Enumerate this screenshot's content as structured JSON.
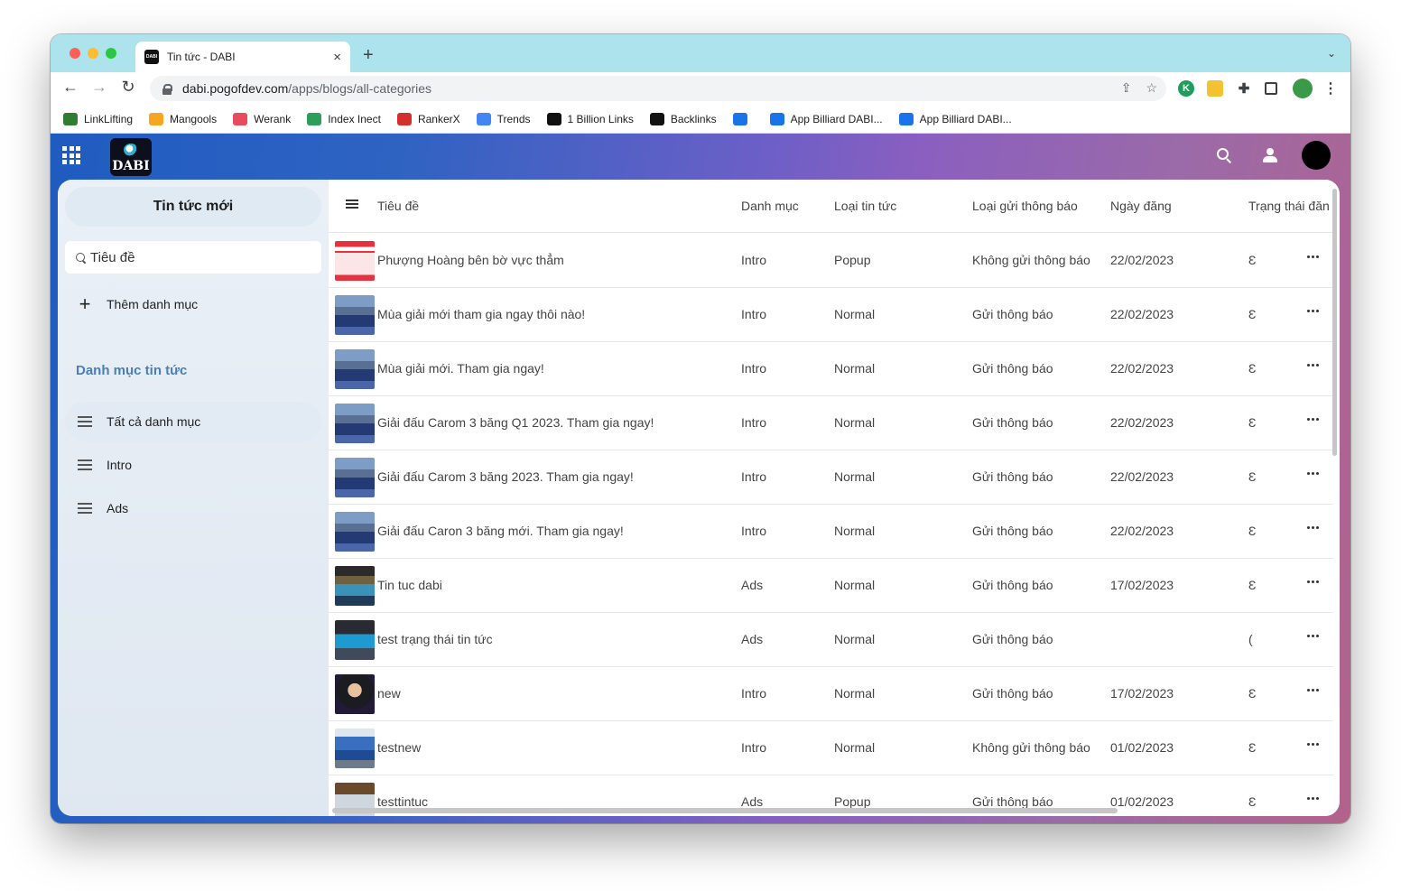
{
  "browser": {
    "tab_title": "Tin tức - DABI",
    "new_tab": "+",
    "url_domain": "dabi.pogofdev.com",
    "url_path": "/apps/blogs/all-categories",
    "tab_close": "×",
    "tab_dropdown": "⌄",
    "favicon_text": "DABI"
  },
  "bookmarks": [
    {
      "label": "LinkLifting",
      "icon_color": "#2e7d32"
    },
    {
      "label": "Mangools",
      "icon_color": "#f5a623"
    },
    {
      "label": "Werank",
      "icon_color": "#e84b5c"
    },
    {
      "label": "Index Inect",
      "icon_color": "#2e9c5a"
    },
    {
      "label": "RankerX",
      "icon_color": "#d32f2f"
    },
    {
      "label": "Trends",
      "icon_color": "#4285f4"
    },
    {
      "label": "1 Billion Links",
      "icon_color": "#111111"
    },
    {
      "label": "Backlinks",
      "icon_color": "#111111"
    },
    {
      "label": "",
      "icon_color": "#1a73e8"
    },
    {
      "label": "App Billiard DABI...",
      "icon_color": "#1a73e8"
    },
    {
      "label": "App Billiard DABI...",
      "icon_color": "#1a73e8"
    }
  ],
  "app": {
    "logo": "DABI"
  },
  "sidebar": {
    "new_button": "Tin tức mới",
    "search_placeholder": "Tiêu đề",
    "add_category": "Thêm danh mục",
    "section_title": "Danh mục tin tức",
    "categories": [
      {
        "label": "Tất cả danh mục",
        "active": true
      },
      {
        "label": "Intro",
        "active": false
      },
      {
        "label": "Ads",
        "active": false
      }
    ]
  },
  "table": {
    "columns": [
      "Tiêu đề",
      "Danh mục",
      "Loại tin tức",
      "Loại gửi thông báo",
      "Ngày đăng",
      "Trạng thái đăn"
    ],
    "rows": [
      {
        "title": "Phượng Hoàng bên bờ vực thẳm",
        "category": "Intro",
        "type": "Popup",
        "notify": "Không gửi thông báo",
        "date": "22/02/2023",
        "status": "Ɛ",
        "thumb": "a"
      },
      {
        "title": "Mùa giải mới tham gia ngay thôi nào!",
        "category": "Intro",
        "type": "Normal",
        "notify": "Gửi thông báo",
        "date": "22/02/2023",
        "status": "Ɛ",
        "thumb": "b"
      },
      {
        "title": "Mùa giải mới. Tham gia ngay!",
        "category": "Intro",
        "type": "Normal",
        "notify": "Gửi thông báo",
        "date": "22/02/2023",
        "status": "Ɛ",
        "thumb": "b"
      },
      {
        "title": "Giải đấu Carom 3 băng Q1 2023. Tham gia ngay!",
        "category": "Intro",
        "type": "Normal",
        "notify": "Gửi thông báo",
        "date": "22/02/2023",
        "status": "Ɛ",
        "thumb": "b"
      },
      {
        "title": "Giải đấu Carom 3 băng 2023. Tham gia ngay!",
        "category": "Intro",
        "type": "Normal",
        "notify": "Gửi thông báo",
        "date": "22/02/2023",
        "status": "Ɛ",
        "thumb": "b"
      },
      {
        "title": "Giải đấu Caron 3 băng mới. Tham gia ngay!",
        "category": "Intro",
        "type": "Normal",
        "notify": "Gửi thông báo",
        "date": "22/02/2023",
        "status": "Ɛ",
        "thumb": "b"
      },
      {
        "title": "Tin tuc dabi",
        "category": "Ads",
        "type": "Normal",
        "notify": "Gửi thông báo",
        "date": "17/02/2023",
        "status": "Ɛ",
        "thumb": "c"
      },
      {
        "title": "test trạng thái tin tức",
        "category": "Ads",
        "type": "Normal",
        "notify": "Gửi thông báo",
        "date": "",
        "status": "(",
        "thumb": "d"
      },
      {
        "title": "new",
        "category": "Intro",
        "type": "Normal",
        "notify": "Gửi thông báo",
        "date": "17/02/2023",
        "status": "Ɛ",
        "thumb": "e"
      },
      {
        "title": "testnew",
        "category": "Intro",
        "type": "Normal",
        "notify": "Không gửi thông báo",
        "date": "01/02/2023",
        "status": "Ɛ",
        "thumb": "f"
      },
      {
        "title": "testtintuc",
        "category": "Ads",
        "type": "Popup",
        "notify": "Gửi thông báo",
        "date": "01/02/2023",
        "status": "Ɛ",
        "thumb": "g"
      }
    ]
  }
}
